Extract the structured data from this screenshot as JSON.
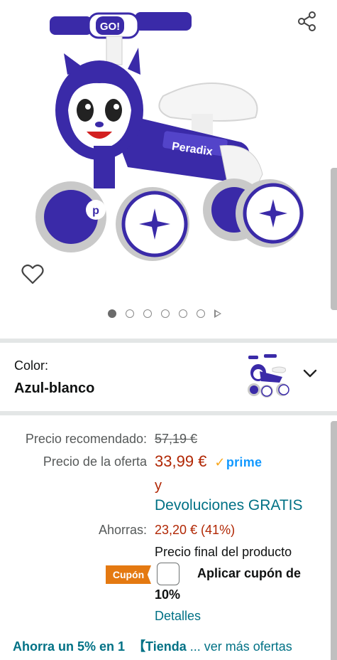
{
  "gallery": {
    "product_image": "balance-bike-image",
    "icons": {
      "share": "share-icon",
      "wishlist": "heart-icon"
    },
    "dots_count": 6,
    "active_dot": 0
  },
  "variation": {
    "label": "Color:",
    "value": "Azul-blanco"
  },
  "pricing": {
    "recommended_label": "Precio recomendado:",
    "recommended_value": "57,19 €",
    "offer_label": "Precio de la oferta",
    "offer_value": "33,99 €",
    "prime_check": "✓",
    "prime_label": "prime",
    "and": "y",
    "returns": "Devoluciones GRATIS",
    "savings_label": "Ahorras:",
    "savings_value": "23,20 € (41%)",
    "final_price_note": "Precio final del producto"
  },
  "coupon": {
    "badge": "Cupón",
    "apply_text_line1": "Aplicar cupón de",
    "apply_text_line2": "10%",
    "details_link": "Detalles"
  },
  "promo": {
    "text_bold": "Ahorra un 5% en 1",
    "store_link": "【Tienda",
    "more": "... ver más ofertas"
  },
  "colors": {
    "price_red": "#b12704",
    "link_teal": "#007185",
    "prime_blue": "#1399ff",
    "coupon_orange": "#e47911",
    "bike_purple": "#3a2aa8"
  }
}
